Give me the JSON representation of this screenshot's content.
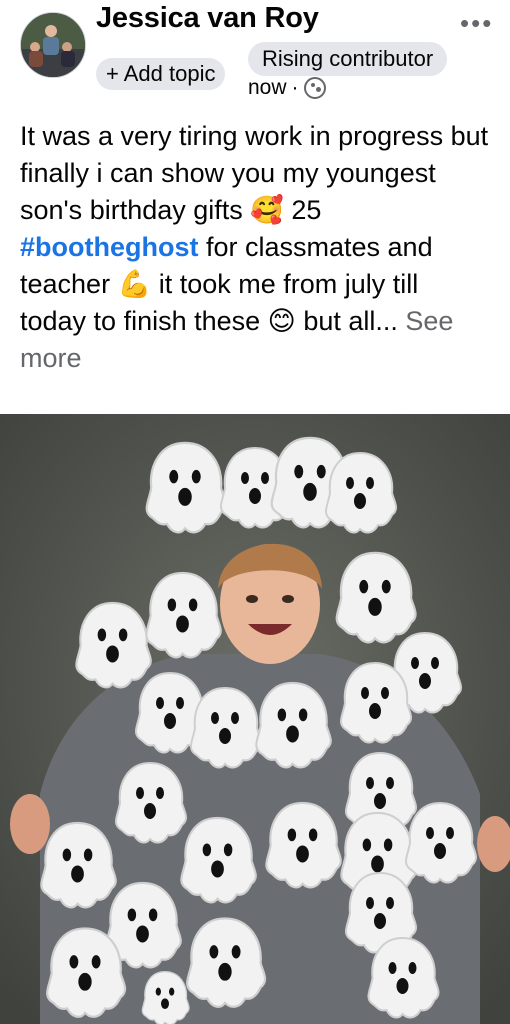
{
  "post": {
    "author": "Jessica van Roy",
    "badge": "Rising contributor",
    "add_topic": "+ Add topic",
    "time": "now",
    "time_separator": "·",
    "more_icon": "more-dots-icon",
    "privacy_icon": "globe-icon"
  },
  "content": {
    "line1": "It was a very tiring work in progress but finally i can show you my youngest son's birthday gifts",
    "emoji1": "🥰",
    "line2": " 25 ",
    "hashtag": "#bootheghost",
    "line3": " for classmates and teacher",
    "emoji2": "💪",
    "line4": " it took me from july till today to finish these",
    "emoji3": "😊",
    "line5": " but all... ",
    "see_more": "See more"
  },
  "photo": {
    "description_icon": "post-photo"
  }
}
